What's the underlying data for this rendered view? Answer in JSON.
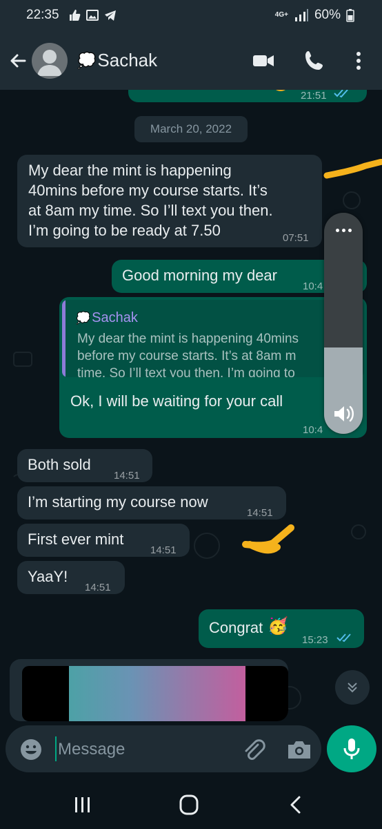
{
  "status_bar": {
    "time": "22:35",
    "network": "4G+",
    "battery": "60%"
  },
  "header": {
    "contact_name": "Sachak",
    "name_emoji_icon": "thought-bubble-icon"
  },
  "chat": {
    "previous_message_time": "21:51",
    "date_chip": "March 20, 2022",
    "messages": [
      {
        "direction": "in",
        "text_lines": [
          "My dear the mint is happening",
          "40mins before my course starts. It’s",
          "at 8am my time. So I’ll text you then.",
          "I’m going to be ready at 7.50"
        ],
        "time": "07:51"
      },
      {
        "direction": "out",
        "text": "Good morning my dear",
        "time": "10:4"
      },
      {
        "direction": "out",
        "quote_author": "Sachak",
        "quote_lines": [
          "My dear the mint is happening 40mins",
          "before my course starts. It’s at 8am m",
          "time. So I’ll text you then. I’m going to"
        ],
        "text": "Ok, I will be waiting for your call",
        "time": "10:4"
      },
      {
        "direction": "in",
        "text": "Both sold",
        "time": "14:51"
      },
      {
        "direction": "in",
        "text": "I’m starting my course now",
        "time": "14:51"
      },
      {
        "direction": "in",
        "text": "First ever mint",
        "time": "14:51"
      },
      {
        "direction": "in",
        "text": "YaaY!",
        "time": "14:51"
      },
      {
        "direction": "out",
        "text": "Congrat",
        "emoji": "🥳",
        "time": "15:23"
      }
    ]
  },
  "volume": {
    "level": 0.39
  },
  "composer": {
    "placeholder": "Message"
  },
  "colors": {
    "background": "#0b141a",
    "bar": "#1f2c34",
    "incoming": "#1f2c34",
    "outgoing": "#005c4b",
    "accent": "#00a884",
    "read_ticks": "#53bdeb",
    "highlight": "#f5b21c"
  }
}
